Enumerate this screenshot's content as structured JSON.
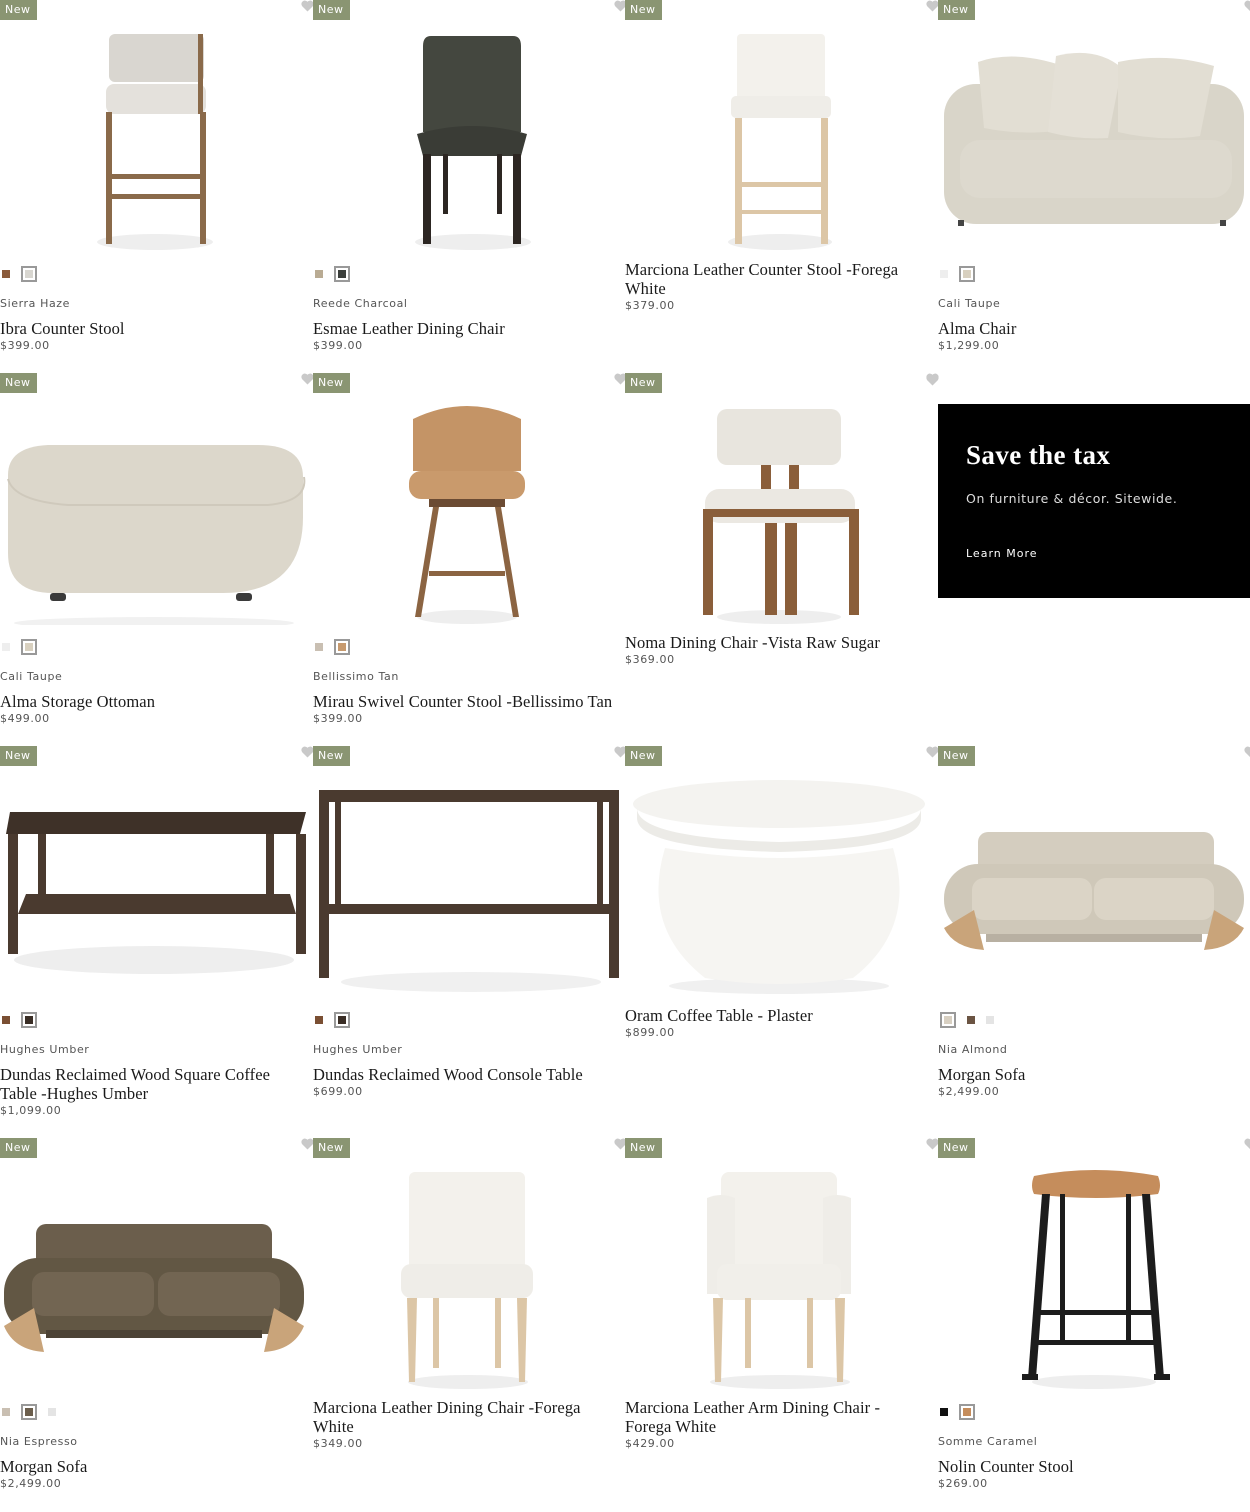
{
  "badge_label": "New",
  "promo": {
    "title": "Save the tax",
    "subtitle": "On furniture & décor. Sitewide.",
    "link": "Learn More"
  },
  "products": [
    {
      "title": "Ibra Counter Stool",
      "variant": "Sierra Haze",
      "price": "$399.00",
      "new": true,
      "swatches": [
        "#8a5a3a",
        "#d8d6d0"
      ],
      "selected": 1,
      "image": "counter-stool-fabric"
    },
    {
      "title": "Esmae Leather Dining Chair",
      "variant": "Reede Charcoal",
      "price": "$399.00",
      "new": true,
      "swatches": [
        "#b9ab93",
        "#3c3f3c"
      ],
      "selected": 1,
      "image": "dining-chair-charcoal"
    },
    {
      "title": "Marciona Leather Counter Stool -Forega White",
      "variant": "",
      "price": "$379.00",
      "new": true,
      "swatches": [],
      "selected": -1,
      "image": "counter-stool-white"
    },
    {
      "title": "Alma Chair",
      "variant": "Cali Taupe",
      "price": "$1,299.00",
      "new": true,
      "swatches": [
        "#eeeeee",
        "#d8d0bf"
      ],
      "selected": 1,
      "image": "lounge-chair"
    },
    {
      "title": "Alma Storage Ottoman",
      "variant": "Cali Taupe",
      "price": "$499.00",
      "new": true,
      "swatches": [
        "#eeeeee",
        "#d8d0bf"
      ],
      "selected": 1,
      "image": "ottoman"
    },
    {
      "title": "Mirau Swivel Counter Stool -Bellissimo Tan",
      "variant": "Bellissimo Tan",
      "price": "$399.00",
      "new": true,
      "swatches": [
        "#c9bfb2",
        "#c79a6e"
      ],
      "selected": 1,
      "image": "swivel-stool"
    },
    {
      "title": "Noma Dining Chair -Vista Raw Sugar",
      "variant": "",
      "price": "$369.00",
      "new": true,
      "swatches": [],
      "selected": -1,
      "image": "noma-chair"
    },
    {
      "title": "Dundas Reclaimed Wood Square Coffee Table -Hughes Umber",
      "variant": "Hughes Umber",
      "price": "$1,099.00",
      "new": true,
      "swatches": [
        "#7a4f33",
        "#3a2e26"
      ],
      "selected": 1,
      "image": "coffee-table"
    },
    {
      "title": "Dundas Reclaimed Wood Console Table",
      "variant": "Hughes Umber",
      "price": "$699.00",
      "new": true,
      "swatches": [
        "#7a4f33",
        "#3a2e26"
      ],
      "selected": 1,
      "image": "console-table"
    },
    {
      "title": "Oram Coffee Table - Plaster",
      "variant": "",
      "price": "$899.00",
      "new": true,
      "swatches": [],
      "selected": -1,
      "image": "plaster-table"
    },
    {
      "title": "Morgan Sofa",
      "variant": "Nia Almond",
      "price": "$2,499.00",
      "new": true,
      "swatches": [
        "#d8d0c2",
        "#6b5443",
        "#e4e4e4"
      ],
      "selected": 0,
      "image": "sofa-almond"
    },
    {
      "title": "Morgan Sofa",
      "variant": "Nia Espresso",
      "price": "$2,499.00",
      "new": true,
      "swatches": [
        "#c9bfb2",
        "#6b5e4c",
        "#e4e4e4"
      ],
      "selected": 1,
      "image": "sofa-espresso"
    },
    {
      "title": "Marciona Leather Dining Chair -Forega White",
      "variant": "",
      "price": "$349.00",
      "new": true,
      "swatches": [],
      "selected": -1,
      "image": "white-dining-chair"
    },
    {
      "title": "Marciona Leather Arm Dining Chair -Forega White",
      "variant": "",
      "price": "$429.00",
      "new": true,
      "swatches": [],
      "selected": -1,
      "image": "white-arm-chair"
    },
    {
      "title": "Nolin Counter Stool",
      "variant": "Somme Caramel",
      "price": "$269.00",
      "new": true,
      "swatches": [
        "#111111",
        "#c58d5c"
      ],
      "selected": 1,
      "image": "nolin-stool"
    }
  ]
}
